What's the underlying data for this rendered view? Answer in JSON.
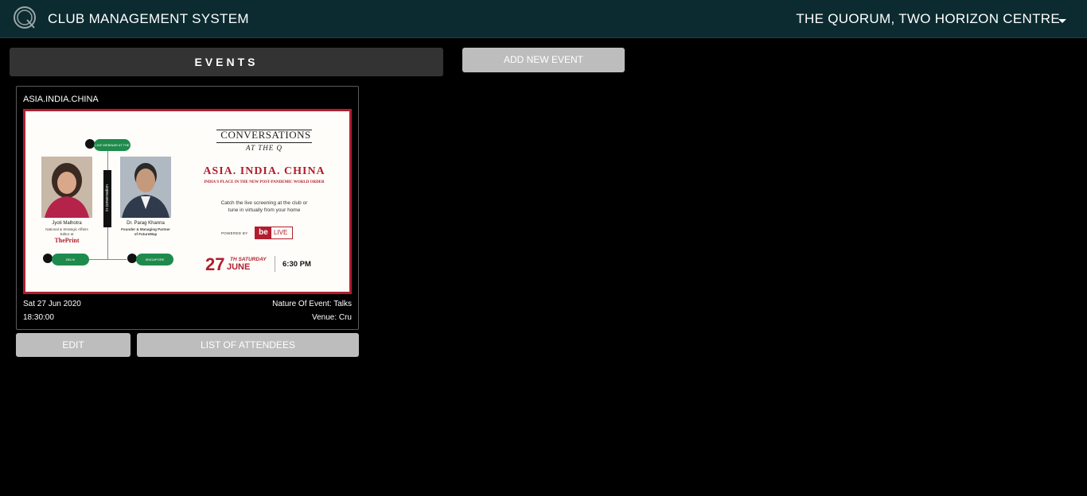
{
  "header": {
    "app_title": "CLUB MANAGEMENT SYSTEM",
    "club_name": "THE QUORUM, TWO HORIZON CENTRE",
    "logo_icon": "q-logo-icon",
    "caret_icon": "caret-down-icon"
  },
  "events_header": "EVENTS",
  "add_event_label": "ADD NEW EVENT",
  "event_card": {
    "title": "ASIA.INDIA.CHINA",
    "date": "Sat 27 Jun 2020",
    "time": "18:30:00",
    "nature": "Nature Of Event: Talks",
    "venue": "Venue: Cru",
    "poster": {
      "pill_top": "LIVE WEBINAR AT THE QUORUM",
      "pill_left": "DELHI",
      "pill_right": "SINGAPORE",
      "vertical_text": "in conversation",
      "speaker1_name": "Jyoti Malhotra",
      "speaker1_role_line1": "National & Strategic Affairs",
      "speaker1_role_line2": "Editor at",
      "speaker1_org": "ThePrint",
      "speaker2_name": "Dr. Parag Khanna",
      "speaker2_role_line1": "Founder & Managing Partner",
      "speaker2_role_line2": "of FutureMap",
      "series_title": "CONVERSATIONS",
      "series_sub": "AT THE Q",
      "headline": "ASIA. INDIA. CHINA",
      "subheadline": "INDIA'S PLACE IN THE NEW POST-PANDEMIC WORLD ORDER",
      "catch_line1": "Catch the live screening at the club or",
      "catch_line2": "tune in virtually from your home",
      "powered_by": "POWERED BY",
      "be": "be",
      "live": "LIVE",
      "day": "27",
      "day_suffix": "TH SATURDAY",
      "month": "JUNE",
      "time": "6:30 PM"
    }
  },
  "edit_label": "EDIT",
  "attendees_label": "LIST OF ATTENDEES",
  "colors": {
    "topbar": "#0b2b30",
    "button": "#bdbdbd",
    "poster_accent": "#b01e2f",
    "pill_green": "#1e8a4c"
  }
}
